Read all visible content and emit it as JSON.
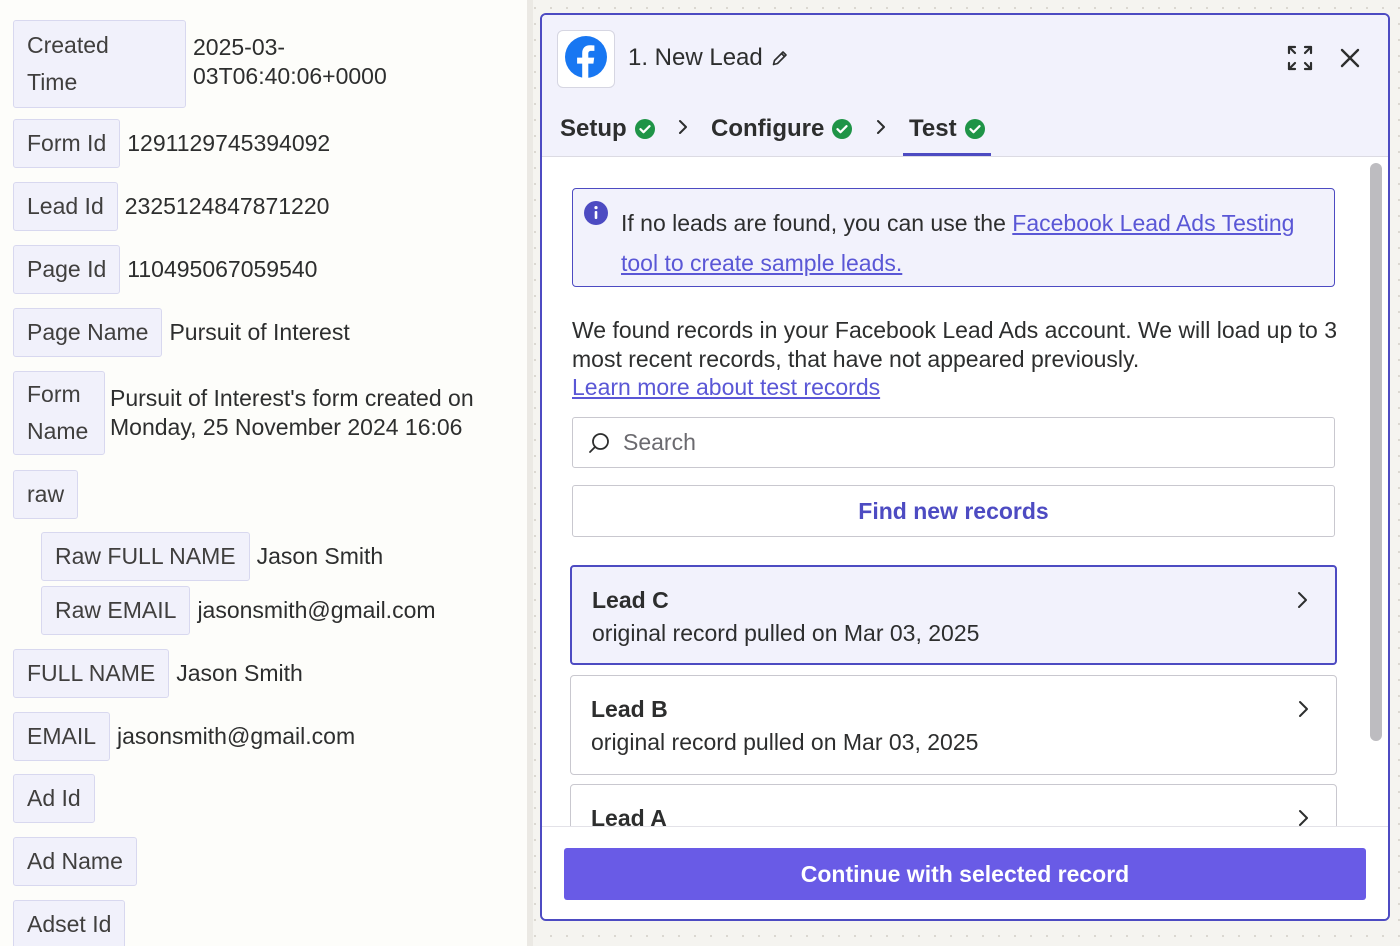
{
  "left_panel": {
    "fields": [
      {
        "key": "Created Time",
        "key_line1": "Created",
        "key_line2": "Time",
        "value_line1": "2025-03-",
        "value_line2": "03T06:40:06+0000"
      },
      {
        "key": "Form Id",
        "value": "1291129745394092"
      },
      {
        "key": "Lead Id",
        "value": "2325124847871220"
      },
      {
        "key": "Page Id",
        "value": "110495067059540"
      },
      {
        "key": "Page Name",
        "value": "Pursuit of Interest"
      },
      {
        "key": "Form Name",
        "key_line1": "Form",
        "key_line2": "Name",
        "value_line1": "Pursuit of Interest's form created on",
        "value_line2": "Monday, 25 November 2024 16:06"
      },
      {
        "key": "raw"
      },
      {
        "key": "Raw FULL NAME",
        "value": "Jason Smith"
      },
      {
        "key": "Raw EMAIL",
        "value": "jasonsmith@gmail.com"
      },
      {
        "key": "FULL NAME",
        "value": "Jason Smith"
      },
      {
        "key": "EMAIL",
        "value": "jasonsmith@gmail.com"
      },
      {
        "key": "Ad Id"
      },
      {
        "key": "Ad Name"
      },
      {
        "key": "Adset Id"
      }
    ]
  },
  "panel": {
    "title": "1. New Lead",
    "app_icon": "facebook-icon",
    "tabs": [
      {
        "label": "Setup",
        "status": "complete"
      },
      {
        "label": "Configure",
        "status": "complete"
      },
      {
        "label": "Test",
        "status": "complete",
        "active": true
      }
    ],
    "info": {
      "text": "If no leads are found, you can use the ",
      "link": "Facebook Lead Ads Testing tool to create sample leads."
    },
    "description": "We found records in your Facebook Lead Ads account. We will load up to 3 most recent records, that have not appeared previously.",
    "learn_more": "Learn more about test records",
    "search": {
      "placeholder": "Search",
      "value": ""
    },
    "find_button": "Find new records",
    "records": [
      {
        "name": "Lead C",
        "subtitle": "original record pulled on Mar 03, 2025",
        "selected": true
      },
      {
        "name": "Lead B",
        "subtitle": "original record pulled on Mar 03, 2025",
        "selected": false
      },
      {
        "name": "Lead A",
        "subtitle": "",
        "selected": false
      }
    ],
    "continue_button": "Continue with selected record"
  },
  "colors": {
    "accent": "#4d4bc2",
    "primary_button": "#695be6",
    "success": "#1f9447",
    "link": "#5a57d6"
  }
}
